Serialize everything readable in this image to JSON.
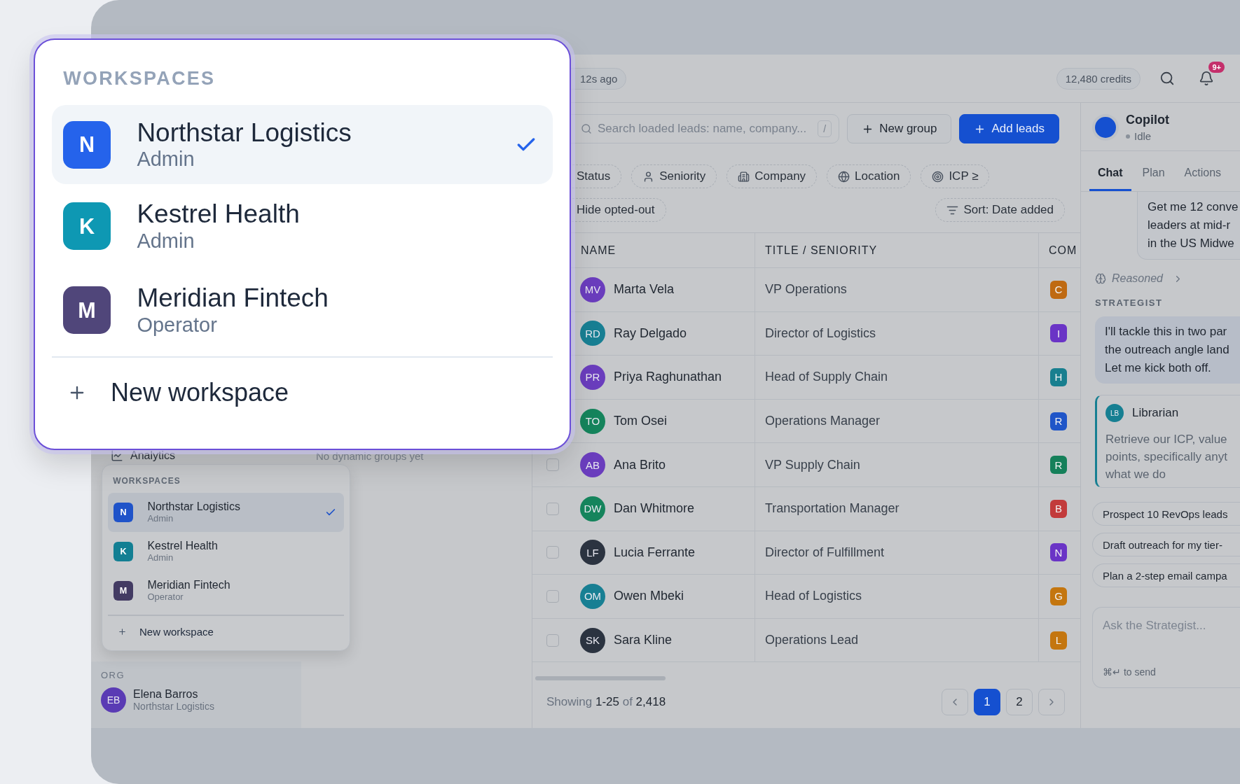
{
  "header": {
    "sync": "12s ago",
    "credits": "12,480 credits",
    "notifications": "9+"
  },
  "sidebar": {
    "nav_item": "Analytics",
    "groups_empty": "No dynamic groups yet",
    "org": {
      "label": "ORG",
      "initials": "EB",
      "name": "Elena Barros",
      "company": "Northstar Logistics",
      "color": "#5a3bb4"
    }
  },
  "toolbar": {
    "search": {
      "placeholder": "Search loaded leads: name, company...",
      "shortcut": "/"
    },
    "buttons": [
      {
        "label": "New group",
        "kind": "secondary"
      },
      {
        "label": "Add leads",
        "kind": "primary"
      }
    ]
  },
  "filters": [
    "Status",
    "Seniority",
    "Company",
    "Location",
    "ICP ≥"
  ],
  "toggles": {
    "hide": "Hide opted-out",
    "sort": "Sort: Date added"
  },
  "table": {
    "columns": [
      "NAME",
      "TITLE / SENIORITY",
      "COM"
    ],
    "rows": [
      {
        "initials": "MV",
        "name": "Marta Vela",
        "title": "VP Operations",
        "color": "#6a3dbd",
        "company": {
          "letter": "C",
          "color": "#bf6a12"
        }
      },
      {
        "initials": "RD",
        "name": "Ray Delgado",
        "title": "Director of Logistics",
        "color": "#187f93",
        "company": {
          "letter": "I",
          "color": "#6a34c6"
        }
      },
      {
        "initials": "PR",
        "name": "Priya Raghunathan",
        "title": "Head of Supply Chain",
        "color": "#6a3dbd",
        "company": {
          "letter": "H",
          "color": "#187f8f"
        }
      },
      {
        "initials": "TO",
        "name": "Tom Osei",
        "title": "Operations Manager",
        "color": "#15845c",
        "company": {
          "letter": "R",
          "color": "#1f55c8"
        }
      },
      {
        "initials": "AB",
        "name": "Ana Brito",
        "title": "VP Supply Chain",
        "color": "#6a3dbd",
        "checked": false,
        "company": {
          "letter": "R",
          "color": "#15805a"
        }
      },
      {
        "initials": "DW",
        "name": "Dan Whitmore",
        "title": "Transportation Manager",
        "color": "#15845c",
        "checked": false,
        "company": {
          "letter": "B",
          "color": "#c23b3b"
        }
      },
      {
        "initials": "LF",
        "name": "Lucia Ferrante",
        "title": "Director of Fulfillment",
        "color": "#2b3340",
        "checked": false,
        "company": {
          "letter": "N",
          "color": "#6a34c6"
        }
      },
      {
        "initials": "OM",
        "name": "Owen Mbeki",
        "title": "Head of Logistics",
        "color": "#187f93",
        "checked": false,
        "company": {
          "letter": "G",
          "color": "#c4760f"
        }
      },
      {
        "initials": "SK",
        "name": "Sara Kline",
        "title": "Operations Lead",
        "color": "#2b3340",
        "checked": false,
        "company": {
          "letter": "L",
          "color": "#c4760f"
        }
      }
    ]
  },
  "footer": {
    "summary": "Showing **1-25** of **2,418**",
    "pages": [
      {
        "label": "1",
        "selected": true
      },
      {
        "label": "2",
        "selected": false
      }
    ]
  },
  "copilot": {
    "title": "Copilot",
    "status": "Idle",
    "tabs": [
      {
        "label": "Chat",
        "selected": true
      },
      {
        "label": "Plan",
        "selected": false
      },
      {
        "label": "Actions",
        "selected": false
      }
    ],
    "user_message": [
      "Get me 12 conve",
      "leaders at mid-r",
      "in the US Midwe"
    ],
    "reasoned": "Reasoned",
    "agent_label": "STRATEGIST",
    "agent_message": [
      "I'll tackle this in two par",
      "the outreach angle land",
      "Let me kick both off."
    ],
    "subagent": {
      "initials": "LB",
      "name": "Librarian",
      "color": "#167f92",
      "task": [
        "Retrieve our ICP, value",
        "points, specifically anyt",
        "what we do"
      ]
    },
    "suggestions": [
      "Prospect 10 RevOps leads",
      "Draft outreach for my tier-",
      "Plan a 2-step email campa"
    ],
    "input": {
      "placeholder": "Ask the Strategist...",
      "hint": "⌘↵ to send"
    }
  },
  "workspace_menu_small": {
    "title": "WORKSPACES",
    "items": [
      {
        "letter": "N",
        "name": "Northstar Logistics",
        "role": "Admin",
        "color": "#1f53c9",
        "selected": true
      },
      {
        "letter": "K",
        "name": "Kestrel Health",
        "role": "Admin",
        "color": "#137f93",
        "selected": false
      },
      {
        "letter": "M",
        "name": "Meridian Fintech",
        "role": "Operator",
        "color": "#433b63",
        "selected": false
      }
    ],
    "new": "New workspace"
  },
  "workspace_menu": {
    "title": "WORKSPACES",
    "items": [
      {
        "letter": "N",
        "name": "Northstar Logistics",
        "role": "Admin",
        "color": "#2563eb",
        "selected": true
      },
      {
        "letter": "K",
        "name": "Kestrel Health",
        "role": "Admin",
        "color": "#0e98b3",
        "selected": false
      },
      {
        "letter": "M",
        "name": "Meridian Fintech",
        "role": "Operator",
        "color": "#50467a",
        "selected": false
      }
    ],
    "new": "New workspace"
  }
}
